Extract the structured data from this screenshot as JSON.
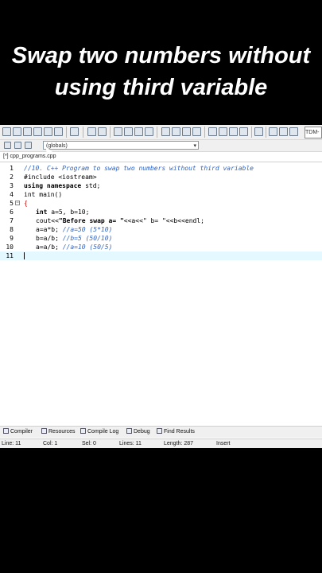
{
  "video_title": {
    "line1": "Swap two numbers without",
    "line2": "using third variable"
  },
  "toolbar": {
    "compiler_label": "TDM-"
  },
  "scope_select": {
    "value": "(globals)"
  },
  "file_tab": {
    "label": "[*] cpp_programs.cpp"
  },
  "code_lines": [
    {
      "n": "1",
      "text": "//10. C++ Program to swap two numbers without third variable"
    },
    {
      "n": "2",
      "text": "#include <iostream>"
    },
    {
      "n": "3",
      "kw": "using namespace",
      "rest": " std;"
    },
    {
      "n": "4",
      "text": "int main()"
    },
    {
      "n": "5",
      "text": "{"
    },
    {
      "n": "6",
      "kw": "int",
      "rest": " a=5, b=10;"
    },
    {
      "n": "7",
      "a": "cout<<",
      "b": "\"Before swap a= \"",
      "c": "<<a<<",
      "d": "\" b= \"",
      "e": "<<b<<endl;"
    },
    {
      "n": "8",
      "code": "a=a*b; ",
      "comment": "//a=50 (5*10)"
    },
    {
      "n": "9",
      "code": "b=a/b; ",
      "comment": "//b=5 (50/10)"
    },
    {
      "n": "10",
      "code": "a=a/b; ",
      "comment": "//a=10 (50/5)"
    },
    {
      "n": "11",
      "text": ""
    }
  ],
  "bottom_tabs": {
    "compiler": "Compiler",
    "resources": "Resources",
    "compile_log": "Compile Log",
    "debug": "Debug",
    "find_results": "Find Results"
  },
  "status": {
    "line_label": "Line:",
    "line_value": "11",
    "col_label": "Col:",
    "col_value": "1",
    "sel_label": "Sel:",
    "sel_value": "0",
    "lines_label": "Lines:",
    "lines_value": "11",
    "length_label": "Length:",
    "length_value": "287",
    "mode": "Insert"
  }
}
